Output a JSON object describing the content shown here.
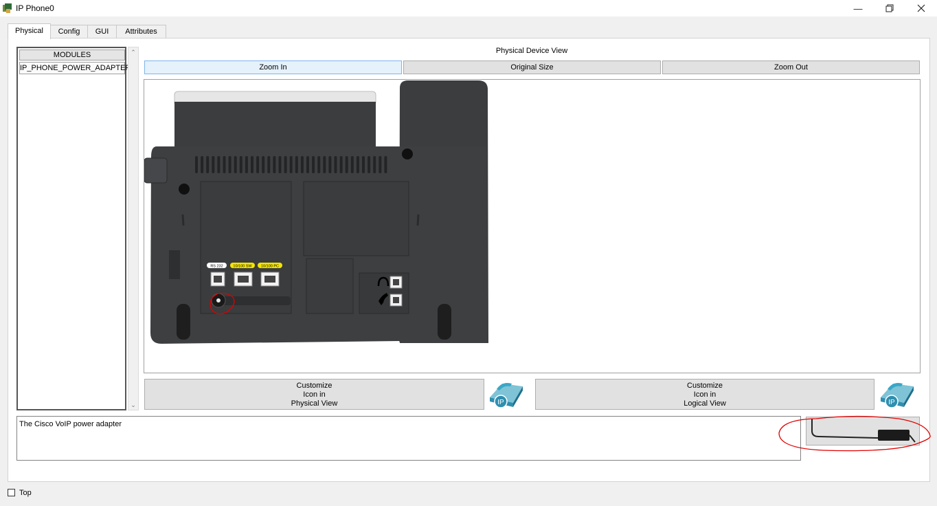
{
  "window": {
    "title": "IP Phone0",
    "controls": [
      "minimize-icon",
      "restore-icon",
      "close-icon"
    ]
  },
  "tabs": [
    {
      "label": "Physical",
      "active": true
    },
    {
      "label": "Config",
      "active": false
    },
    {
      "label": "GUI",
      "active": false
    },
    {
      "label": "Attributes",
      "active": false
    }
  ],
  "modules": {
    "header": "MODULES",
    "items": [
      "IP_PHONE_POWER_ADAPTER"
    ]
  },
  "view": {
    "title": "Physical Device View",
    "zoom_in": "Zoom In",
    "original_size": "Original Size",
    "zoom_out": "Zoom Out"
  },
  "device": {
    "port_labels": [
      "RS 232",
      "10/100 SW",
      "10/100 PC"
    ],
    "body_color": "#3d3f41",
    "label_yellow": "#f4e400",
    "annotation_color": "#e00000"
  },
  "customize": {
    "physical_lines": [
      "Customize",
      "Icon in",
      "Physical View"
    ],
    "logical_lines": [
      "Customize",
      "Icon in",
      "Logical View"
    ],
    "ip_badge": "IP"
  },
  "description": "The Cisco VoIP power adapter",
  "footer": {
    "top_label": "Top",
    "top_checked": false
  }
}
